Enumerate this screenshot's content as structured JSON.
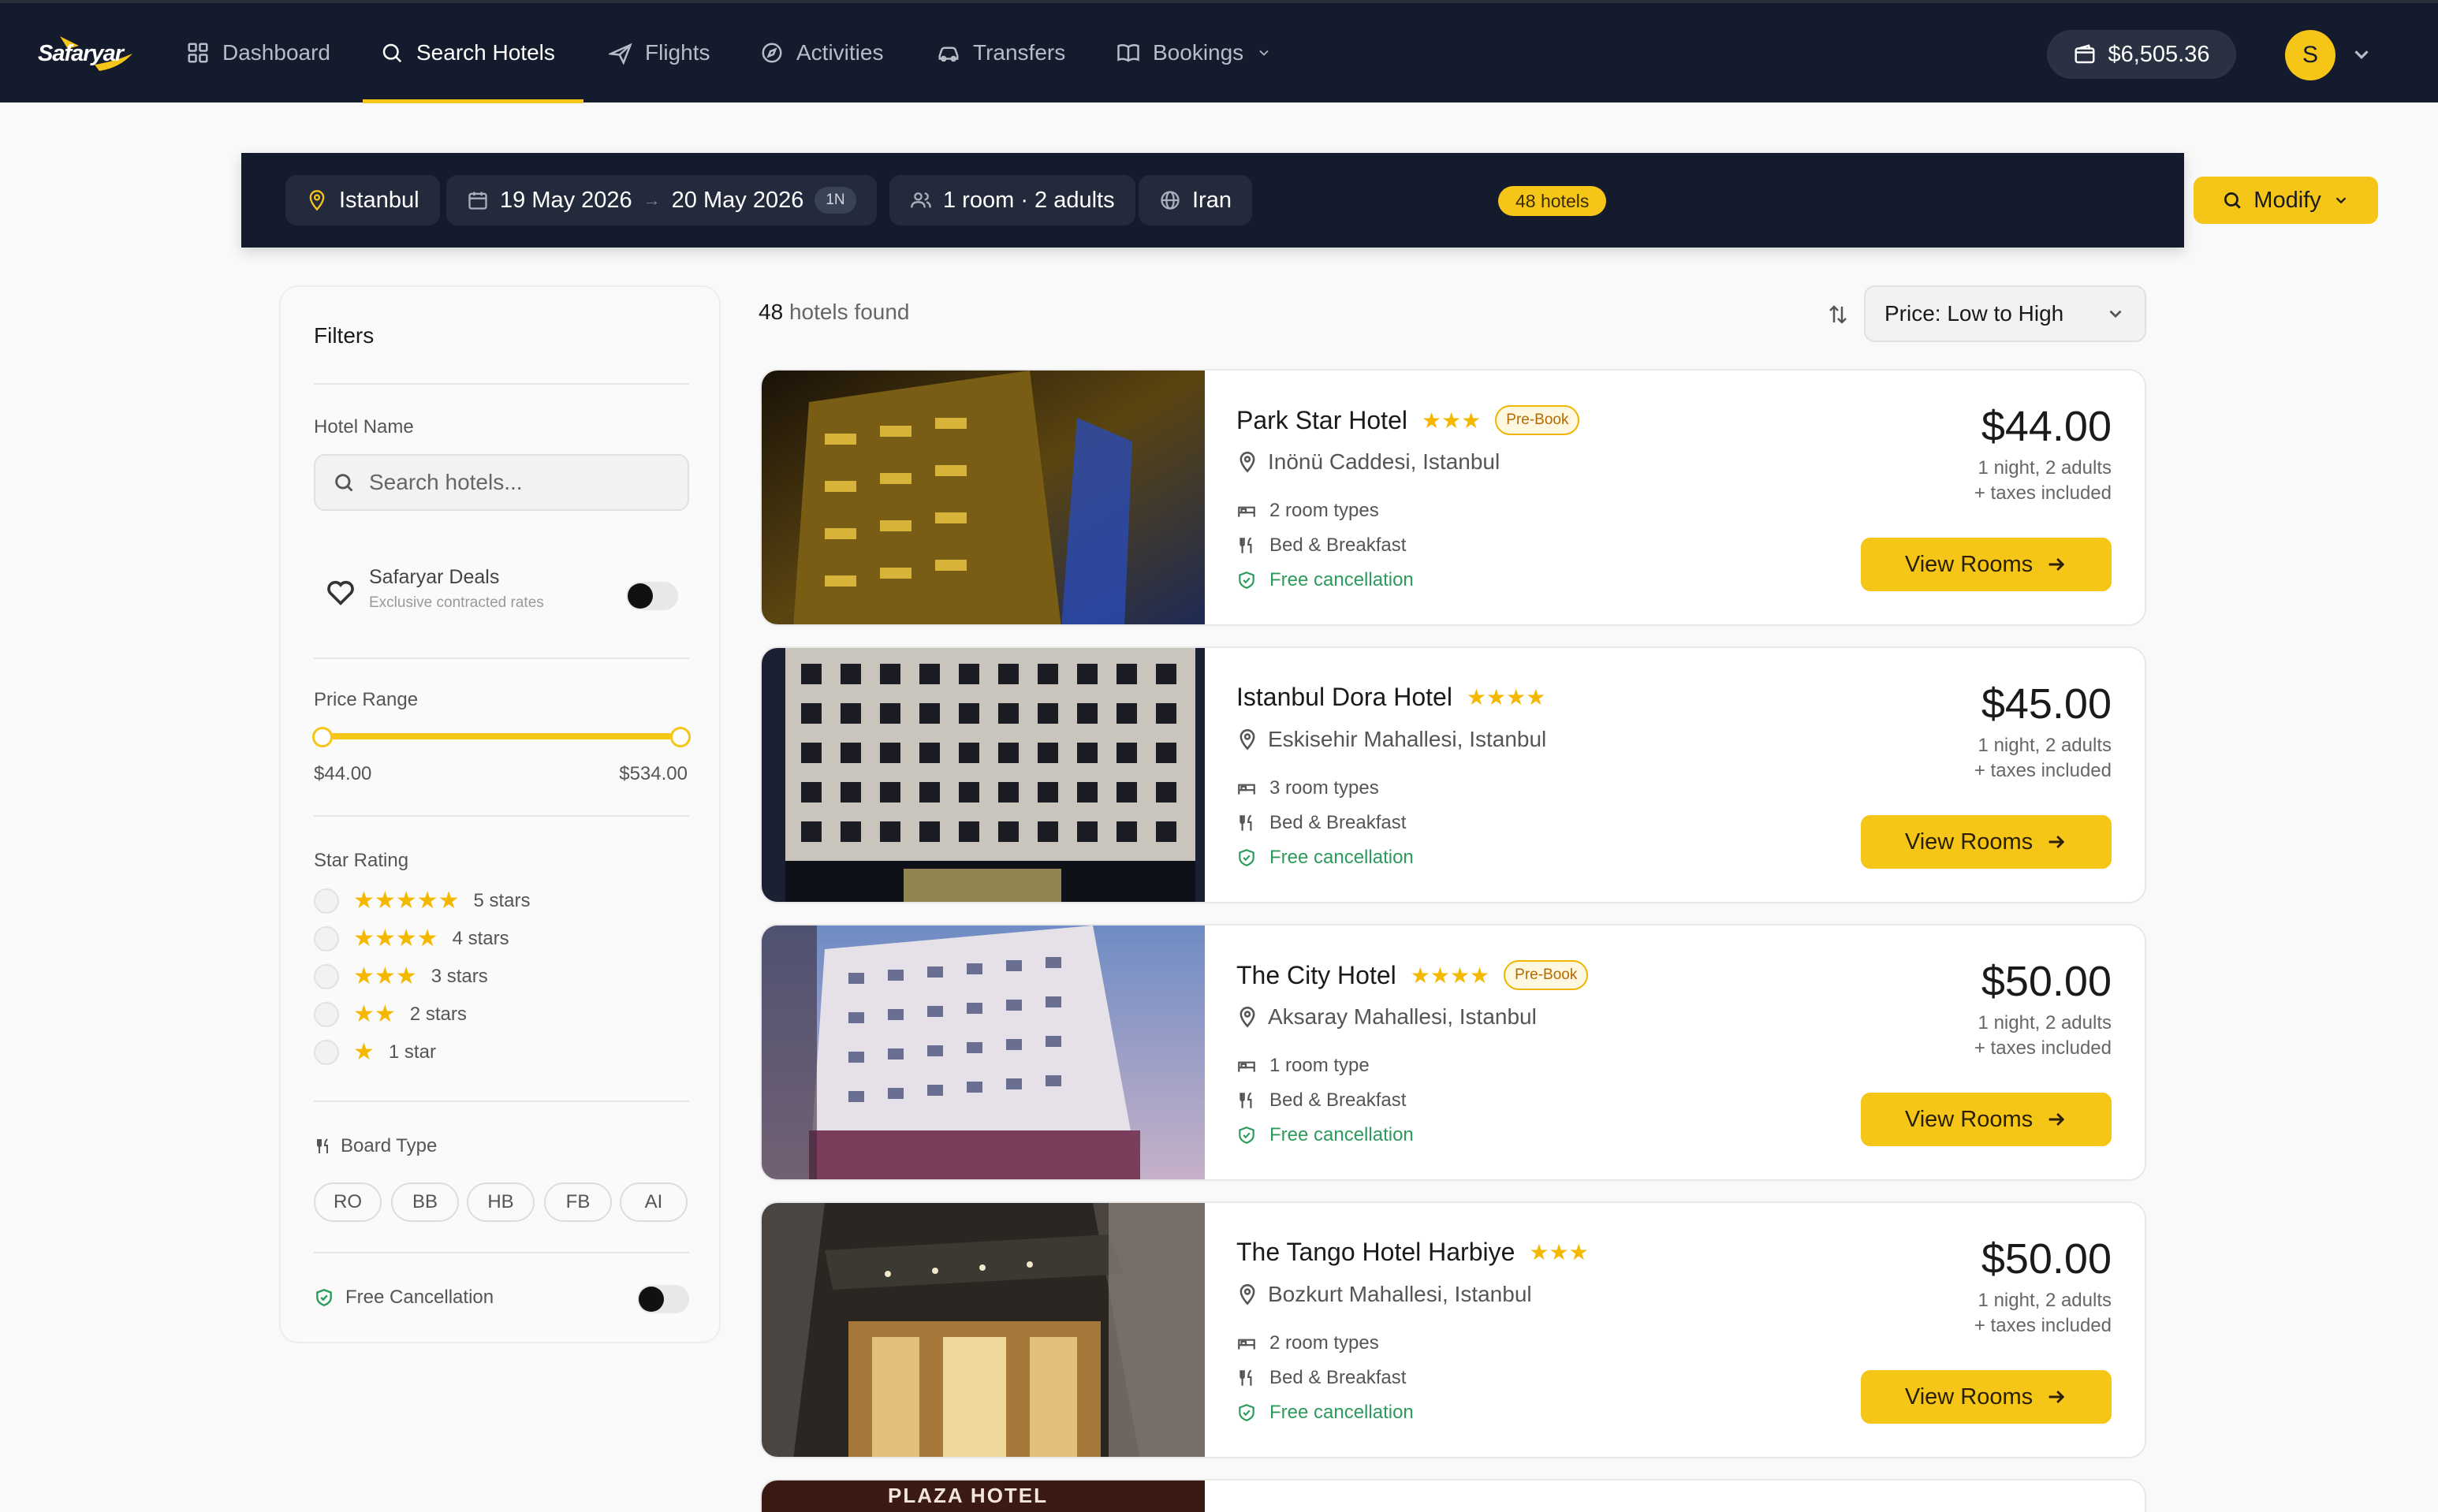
{
  "brand": {
    "name": "Safaryar",
    "accent": "#f5c518",
    "nav_bg": "#141b2d"
  },
  "nav": {
    "items": [
      {
        "label": "Dashboard"
      },
      {
        "label": "Search Hotels"
      },
      {
        "label": "Flights"
      },
      {
        "label": "Activities"
      },
      {
        "label": "Transfers"
      },
      {
        "label": "Bookings"
      }
    ],
    "balance": "$6,505.36",
    "avatar_initial": "S"
  },
  "search": {
    "destination": "Istanbul",
    "checkin": "19 May 2026",
    "checkout": "20 May 2026",
    "nights": "1N",
    "guests": "1 room · 2 adults",
    "nationality": "Iran",
    "count_badge": "48 hotels",
    "modify_label": "Modify"
  },
  "filters": {
    "title": "Filters",
    "hotel_name_label": "Hotel Name",
    "hotel_name_placeholder": "Search hotels...",
    "deals_title": "Safaryar Deals",
    "deals_subtitle": "Exclusive contracted rates",
    "price_range_label": "Price Range",
    "price_min": "$44.00",
    "price_max": "$534.00",
    "star_rating_label": "Star Rating",
    "star_options": [
      {
        "stars": "★★★★★",
        "label": "5 stars"
      },
      {
        "stars": "★★★★",
        "label": "4 stars"
      },
      {
        "stars": "★★★",
        "label": "3 stars"
      },
      {
        "stars": "★★",
        "label": "2 stars"
      },
      {
        "stars": "★",
        "label": "1 star"
      }
    ],
    "board_type_label": "Board Type",
    "board_types": [
      "RO",
      "BB",
      "HB",
      "FB",
      "AI"
    ],
    "free_cancellation_label": "Free Cancellation"
  },
  "results": {
    "count": "48",
    "count_suffix": "hotels found",
    "sort_label": "Price: Low to High",
    "view_rooms_label": "View Rooms",
    "hotels": [
      {
        "name": "Park Star Hotel",
        "stars": "★★★",
        "prebook": "Pre-Book",
        "address": "Inönü Caddesi, Istanbul",
        "room_types": "2 room types",
        "board": "Bed & Breakfast",
        "cancellation": "Free cancellation",
        "price": "$44.00",
        "price_note": "1 night, 2 adults",
        "tax_note": "+ taxes included"
      },
      {
        "name": "Istanbul Dora Hotel",
        "stars": "★★★★",
        "prebook": "",
        "address": "Eskisehir Mahallesi, Istanbul",
        "room_types": "3 room types",
        "board": "Bed & Breakfast",
        "cancellation": "Free cancellation",
        "price": "$45.00",
        "price_note": "1 night, 2 adults",
        "tax_note": "+ taxes included"
      },
      {
        "name": "The City Hotel",
        "stars": "★★★★",
        "prebook": "Pre-Book",
        "address": "Aksaray Mahallesi, Istanbul",
        "room_types": "1 room type",
        "board": "Bed & Breakfast",
        "cancellation": "Free cancellation",
        "price": "$50.00",
        "price_note": "1 night, 2 adults",
        "tax_note": "+ taxes included"
      },
      {
        "name": "The Tango Hotel Harbiye",
        "stars": "★★★",
        "prebook": "",
        "address": "Bozkurt Mahallesi, Istanbul",
        "room_types": "2 room types",
        "board": "Bed & Breakfast",
        "cancellation": "Free cancellation",
        "price": "$50.00",
        "price_note": "1 night, 2 adults",
        "tax_note": "+ taxes included"
      }
    ],
    "partial_image_text": "PLAZA HOTEL"
  }
}
